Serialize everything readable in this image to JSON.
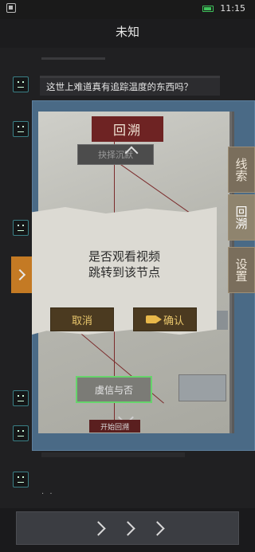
{
  "status_bar": {
    "time": "11:15",
    "battery_color": "#3ec25a"
  },
  "header": {
    "title": "未知"
  },
  "chat": {
    "messages": [
      {
        "text": "这世上难道真有追踪温度的东西吗？"
      }
    ],
    "typing_dots": ". ."
  },
  "map": {
    "title": "回溯",
    "select_label": "抉择沉默",
    "node_inquiry": "虞信与否",
    "node_start": "开始回溯",
    "side_tabs": [
      "线索",
      "回溯",
      "设置"
    ]
  },
  "dialog": {
    "line1": "是否观看视频",
    "line2": "跳转到该节点",
    "cancel": "取消",
    "confirm": "确认"
  },
  "bottom": {
    "next_icon": "triple-chevron-right"
  }
}
